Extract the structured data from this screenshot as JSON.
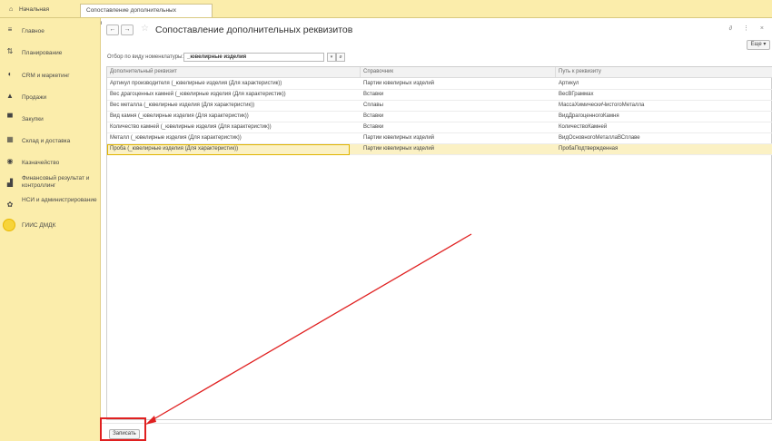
{
  "tabs": {
    "home": "Начальная страница",
    "active": "Сопоставление дополнительных реквизитов",
    "close": "×"
  },
  "sidebar": {
    "items": [
      {
        "label": "Главное",
        "icon": "menu-icon",
        "glyph": "≡"
      },
      {
        "label": "Планирование",
        "icon": "planning-icon",
        "glyph": "⇅"
      },
      {
        "label": "CRM и маркетинг",
        "icon": "crm-icon",
        "glyph": "◐"
      },
      {
        "label": "Продажи",
        "icon": "sales-icon",
        "glyph": "▲"
      },
      {
        "label": "Закупки",
        "icon": "cart-icon",
        "glyph": "▀"
      },
      {
        "label": "Склад и доставка",
        "icon": "warehouse-icon",
        "glyph": "▦"
      },
      {
        "label": "Казначейство",
        "icon": "treasury-icon",
        "glyph": "◉"
      },
      {
        "label": "Финансовый результат и контроллинг",
        "icon": "chart-icon",
        "glyph": "▟"
      },
      {
        "label": "НСИ и администрирование",
        "icon": "gear-icon",
        "glyph": "✿"
      },
      {
        "label": "ГИИС ДМДК",
        "icon": "dmdk-circle-icon",
        "glyph": ""
      }
    ]
  },
  "header": {
    "back": "←",
    "forward": "→",
    "star": "☆",
    "title": "Сопоставление дополнительных реквизитов",
    "right_icons": "∂ ⋮ ×",
    "more": "Еще ▾"
  },
  "filter": {
    "label": "Отбор по виду номенклатуры:",
    "value": "_ювелирные изделия",
    "dropdown": "▾",
    "open": "ø"
  },
  "table": {
    "columns": [
      "Дополнительный реквизит",
      "Справочник",
      "Путь к реквизиту"
    ],
    "rows": [
      [
        "Артикул производителя (_ювелирные изделия (Для характеристик))",
        "Партии ювелирных изделий",
        "Артикул"
      ],
      [
        "Вес драгоценных камней (_ювелирные изделия (Для характеристик))",
        "Вставки",
        "ВесВГраммах"
      ],
      [
        "Вес металла (_ювелирные изделия (Для характеристик))",
        "Сплавы",
        "МассаХимическиЧистогоМеталла"
      ],
      [
        "Вид камня (_ювелирные изделия (Для характеристик))",
        "Вставки",
        "ВидДрагоценногоКамня"
      ],
      [
        "Количество камней (_ювелирные изделия (Для характеристик))",
        "Вставки",
        "КоличествоКамней"
      ],
      [
        "Металл (_ювелирные изделия (Для характеристик))",
        "Партии ювелирных изделий",
        "ВидОсновногоМеталлаВСплаве"
      ],
      [
        "Проба (_ювелирные изделия (Для характеристик))",
        "Партии ювелирных изделий",
        "ПробаПодтвержденная"
      ]
    ],
    "selected_row": 6
  },
  "footer": {
    "save": "Записать"
  },
  "colors": {
    "sidebar_bg": "#fbedab",
    "selected_row": "#fbf1c4",
    "annotation": "#e02020"
  }
}
